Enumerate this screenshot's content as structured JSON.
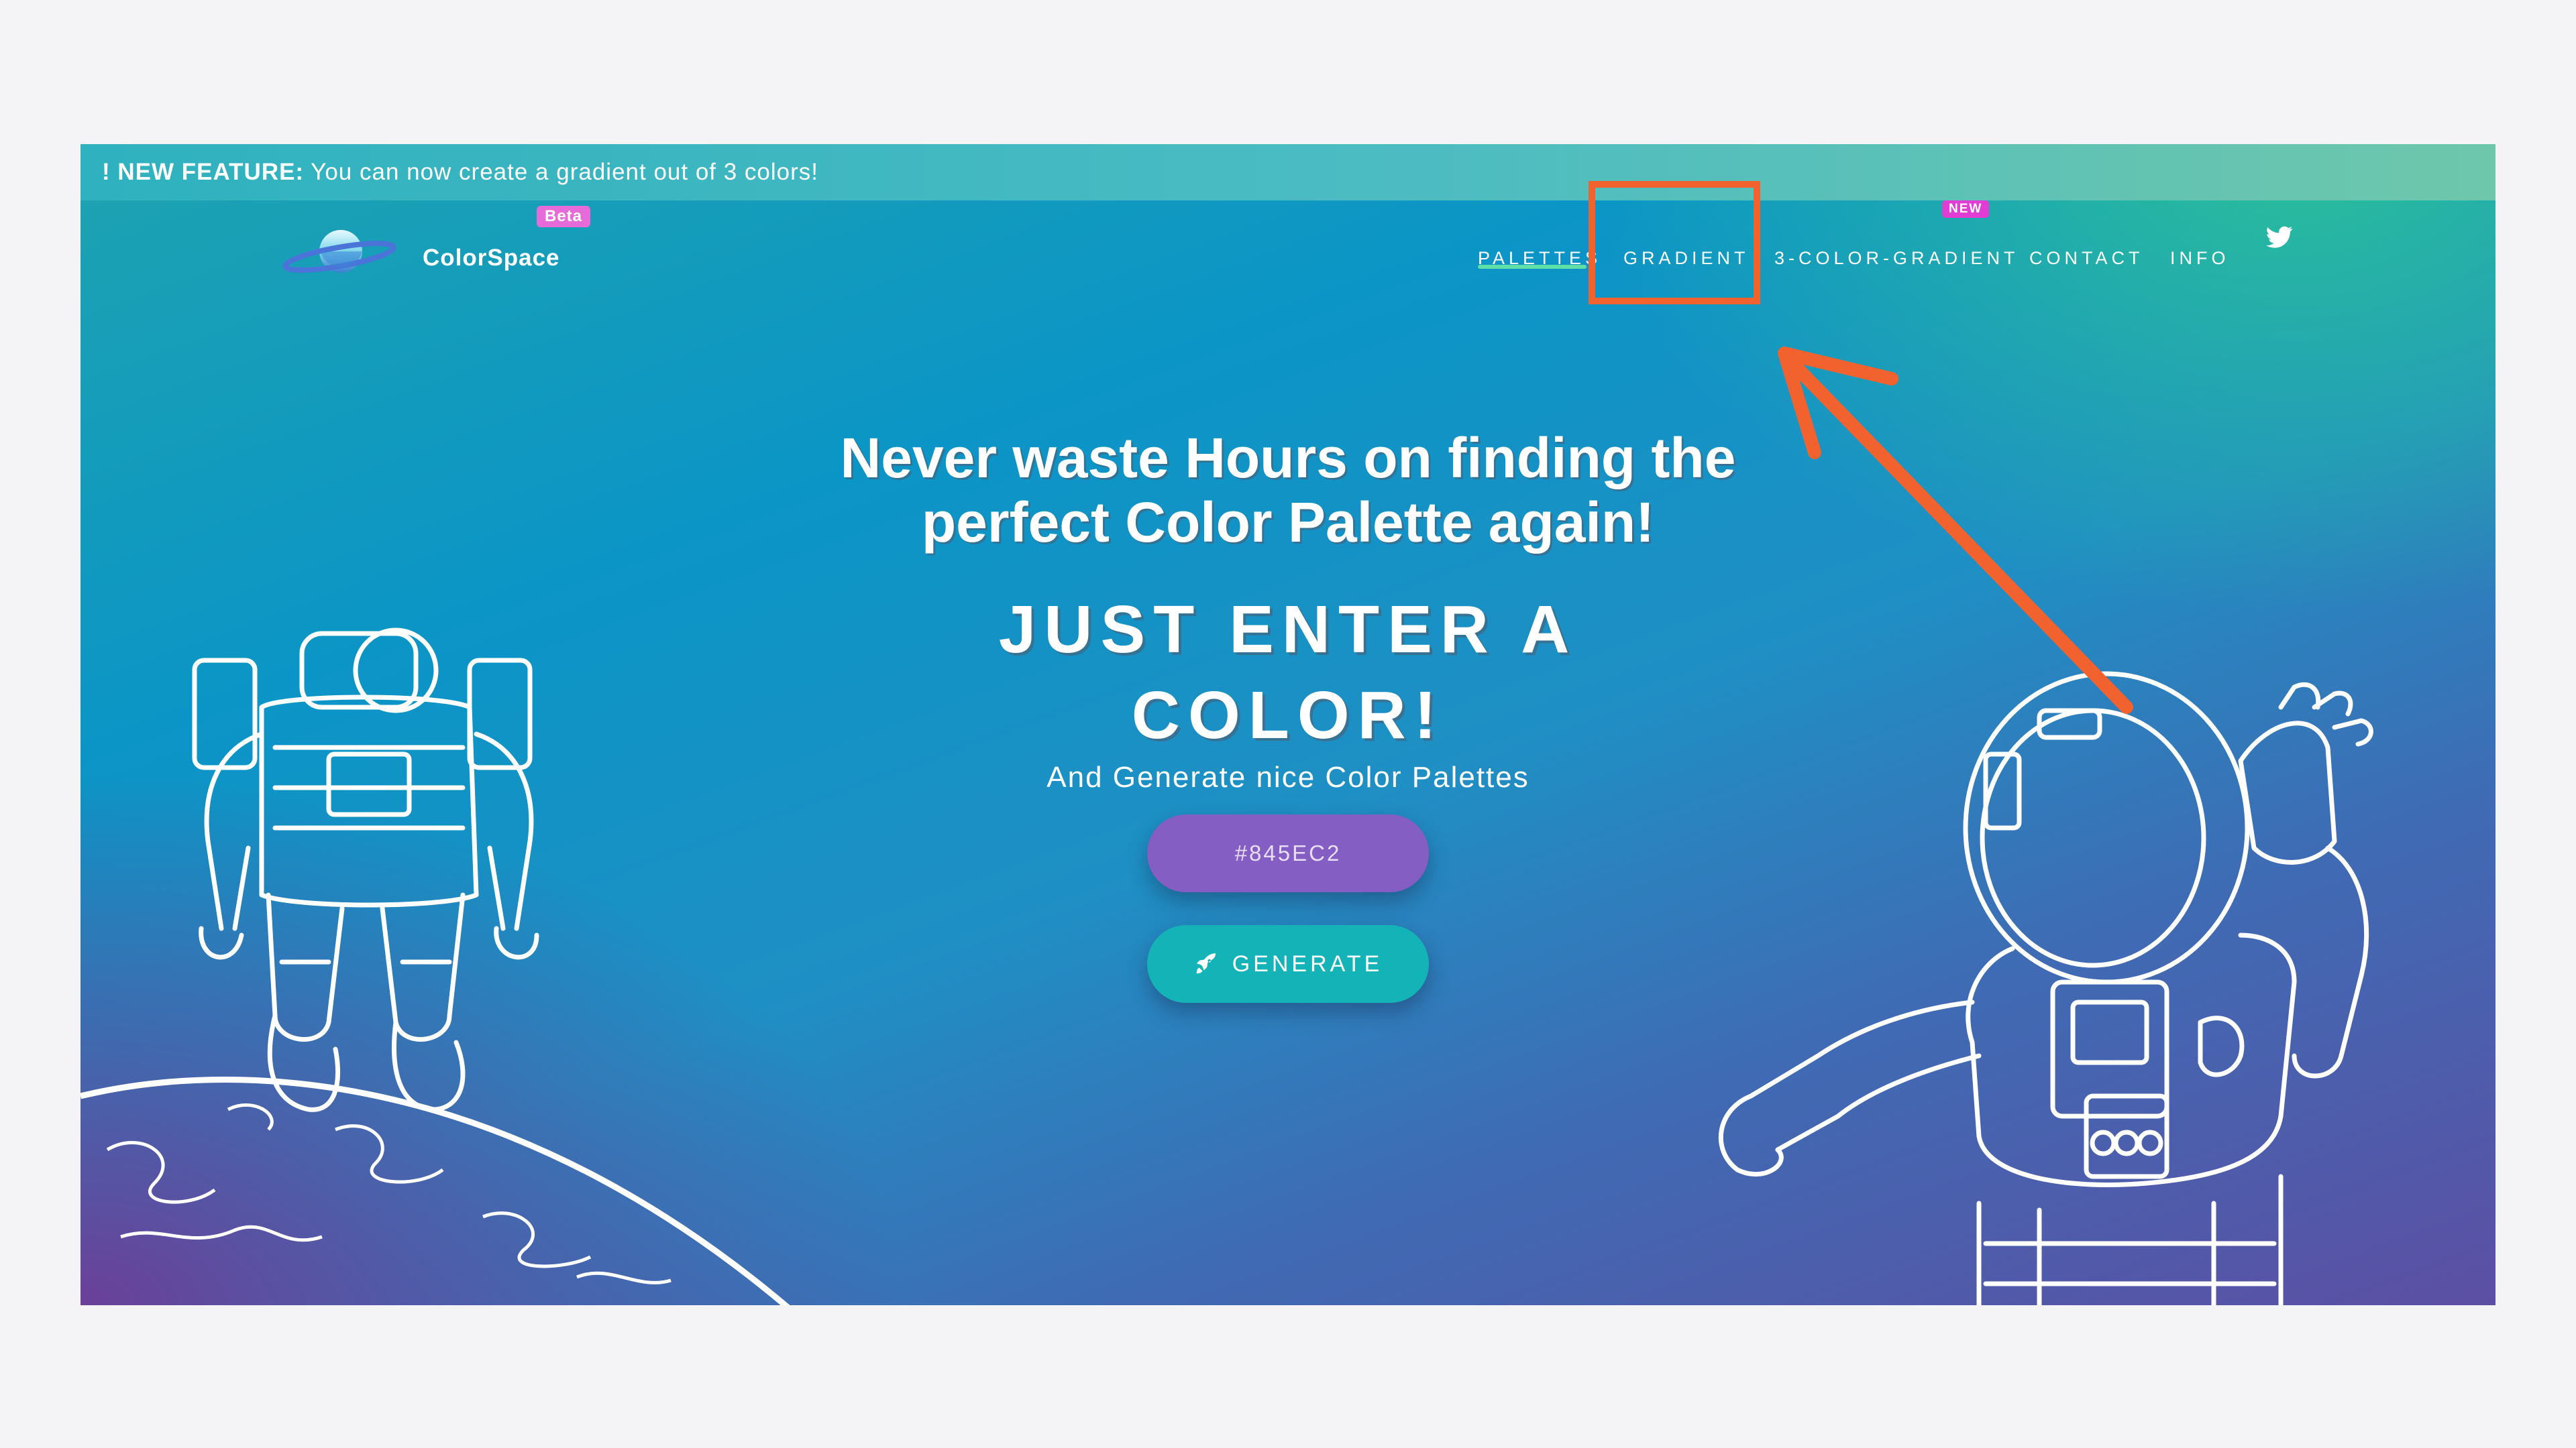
{
  "banner": {
    "prefix": "! NEW FEATURE:",
    "text": " You can now create a gradient out of 3 colors!"
  },
  "brand": {
    "name": "ColorSpace",
    "badge": "Beta",
    "icon": "saturn-planet-icon"
  },
  "nav": {
    "items": [
      {
        "label": "PALETTES",
        "active": true
      },
      {
        "label": "GRADIENT",
        "active": false
      },
      {
        "label": "3-COLOR-GRADIENT",
        "active": false,
        "badge": "NEW"
      },
      {
        "label": "CONTACT",
        "active": false
      },
      {
        "label": "INFO",
        "active": false
      }
    ],
    "social_icon": "twitter-icon"
  },
  "hero": {
    "headline_line1": "Never waste Hours on finding the",
    "headline_line2": "perfect Color Palette again!",
    "subhead_line1": "JUST ENTER A",
    "subhead_line2": "COLOR!",
    "tagline": "And Generate nice Color Palettes"
  },
  "color_input": {
    "value": "#845EC2"
  },
  "generate_button": {
    "label": "GENERATE",
    "icon": "rocket-icon"
  },
  "annotation": {
    "highlight": "nav.items.1",
    "color": "#f2622e"
  },
  "colors": {
    "accent_purple": "#845ec2",
    "button_teal": "#14b3b8",
    "beta_badge": "#e66ad8",
    "new_badge": "#e13dd4",
    "active_underline": "#5fe0a8"
  }
}
